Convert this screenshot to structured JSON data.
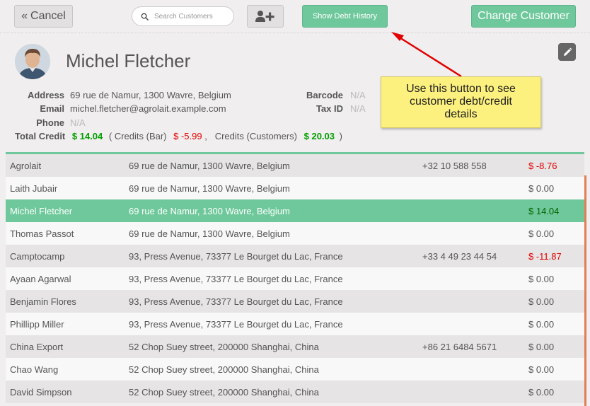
{
  "topbar": {
    "cancel_label": "Cancel",
    "search_placeholder": "Search Customers",
    "debt_history_label": "Show Debt History",
    "change_customer_label": "Change Customer"
  },
  "customer": {
    "name": "Michel Fletcher",
    "address_label": "Address",
    "address": "69 rue de Namur, 1300 Wavre, Belgium",
    "email_label": "Email",
    "email": "michel.fletcher@agrolait.example.com",
    "phone_label": "Phone",
    "phone": "N/A",
    "barcode_label": "Barcode",
    "barcode": "N/A",
    "taxid_label": "Tax ID",
    "taxid": "N/A",
    "total_credit_label": "Total Credit",
    "total_credit": "$ 14.04",
    "credits_bar_label": "( Credits (Bar)",
    "credits_bar": "$ -5.99",
    "credits_customers_label": ",   Credits (Customers)",
    "credits_customers": "$ 20.03",
    "close_paren": ")"
  },
  "callout": {
    "text_line1": "Use this button to see",
    "text_line2": "customer debt/credit",
    "text_line3": "details"
  },
  "colors": {
    "accent_green": "#6ec89b",
    "negative_red": "#e20000",
    "positive_green": "#00a000"
  },
  "rows": [
    {
      "name": "Agrolait",
      "address": "69 rue de Namur, 1300 Wavre, Belgium",
      "phone": "+32 10 588 558",
      "balance": "$ -8.76",
      "negative": true
    },
    {
      "name": "Laith Jubair",
      "address": "69 rue de Namur, 1300 Wavre, Belgium",
      "phone": "",
      "balance": "$ 0.00",
      "negative": false
    },
    {
      "name": "Michel Fletcher",
      "address": "69 rue de Namur, 1300 Wavre, Belgium",
      "phone": "",
      "balance": "$ 14.04",
      "negative": false,
      "selected": true
    },
    {
      "name": "Thomas Passot",
      "address": "69 rue de Namur, 1300 Wavre, Belgium",
      "phone": "",
      "balance": "$ 0.00",
      "negative": false
    },
    {
      "name": "Camptocamp",
      "address": "93, Press Avenue, 73377 Le Bourget du Lac, France",
      "phone": "+33 4 49 23 44 54",
      "balance": "$ -11.87",
      "negative": true
    },
    {
      "name": "Ayaan Agarwal",
      "address": "93, Press Avenue, 73377 Le Bourget du Lac, France",
      "phone": "",
      "balance": "$ 0.00",
      "negative": false
    },
    {
      "name": "Benjamin Flores",
      "address": "93, Press Avenue, 73377 Le Bourget du Lac, France",
      "phone": "",
      "balance": "$ 0.00",
      "negative": false
    },
    {
      "name": "Phillipp Miller",
      "address": "93, Press Avenue, 73377 Le Bourget du Lac, France",
      "phone": "",
      "balance": "$ 0.00",
      "negative": false
    },
    {
      "name": "China Export",
      "address": "52 Chop Suey street, 200000 Shanghai, China",
      "phone": "+86 21 6484 5671",
      "balance": "$ 0.00",
      "negative": false
    },
    {
      "name": "Chao Wang",
      "address": "52 Chop Suey street, 200000 Shanghai, China",
      "phone": "",
      "balance": "$ 0.00",
      "negative": false
    },
    {
      "name": "David Simpson",
      "address": "52 Chop Suey street, 200000 Shanghai, China",
      "phone": "",
      "balance": "$ 0.00",
      "negative": false
    }
  ]
}
